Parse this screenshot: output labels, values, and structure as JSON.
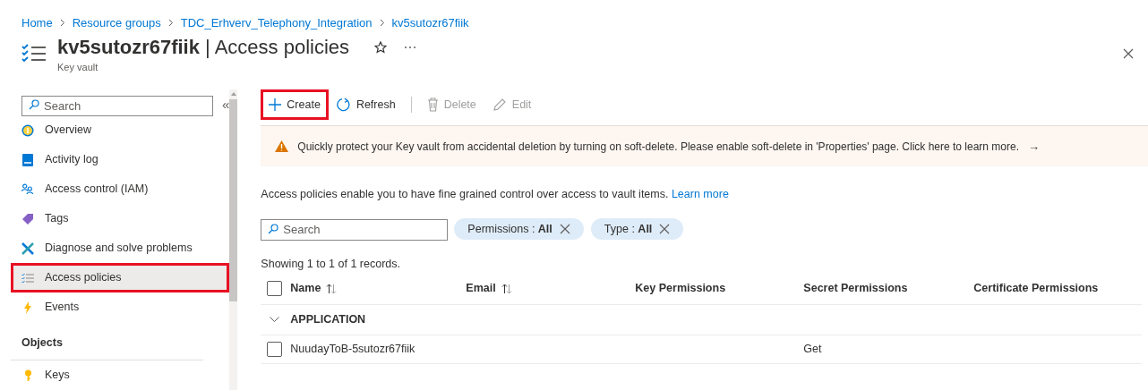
{
  "breadcrumb": [
    "Home",
    "Resource groups",
    "TDC_Erhverv_Telephony_Integration",
    "kv5sutozr67fiik"
  ],
  "header": {
    "title": "**kv5sutozr67fiik** | Access policies",
    "subtitle": "Key vault"
  },
  "sidebar": {
    "search": {
      "placeholder": "Search"
    },
    "collapse": "«",
    "items": [
      {
        "label": "Overview",
        "selected": false,
        "highlighted": false
      },
      {
        "label": "Activity log",
        "selected": false,
        "highlighted": false
      },
      {
        "label": "Access control (IAM)",
        "selected": false,
        "highlighted": false
      },
      {
        "label": "Tags",
        "selected": false,
        "highlighted": false
      },
      {
        "label": "Diagnose and solve problems",
        "selected": false,
        "highlighted": false
      },
      {
        "label": "Access policies",
        "selected": true,
        "highlighted": true
      },
      {
        "label": "Events",
        "selected": false,
        "highlighted": false
      }
    ],
    "sections": [
      {
        "title": "Objects",
        "items": [
          {
            "label": "Keys",
            "selected": false,
            "highlighted": false
          }
        ]
      }
    ]
  },
  "toolbar": [
    {
      "label": "Create",
      "disabled": false,
      "highlighted": true
    },
    {
      "label": "Refresh",
      "disabled": false,
      "highlighted": false
    },
    {
      "label": "Delete",
      "disabled": true,
      "highlighted": false
    },
    {
      "label": "Edit",
      "disabled": true,
      "highlighted": false
    }
  ],
  "banner": {
    "text": "Quickly protect your Key vault from accidental deletion by turning on soft-delete. Please enable soft-delete in 'Properties' page. Click here to learn more.",
    "arrow": "→"
  },
  "description": {
    "text": "Access policies enable you to have fine grained control over access to vault items.",
    "link": "Learn more"
  },
  "search": {
    "placeholder": "Search"
  },
  "filters": [
    {
      "label": "Permissions : ",
      "value": "All"
    },
    {
      "label": "Type : ",
      "value": "All"
    }
  ],
  "record_count": "Showing 1 to 1 of 1 records.",
  "table": {
    "select_all": {
      "checked": false
    },
    "columns": [
      {
        "label": "Name",
        "sortable": true
      },
      {
        "label": "Email",
        "sortable": true
      },
      {
        "label": "Key Permissions",
        "sortable": false
      },
      {
        "label": "Secret Permissions",
        "sortable": false
      },
      {
        "label": "Certificate Permissions",
        "sortable": false
      }
    ],
    "groups": [
      {
        "label": "APPLICATION",
        "expanded": true,
        "rows": [
          {
            "checked": false,
            "cells": [
              "NuudayToB-5sutozr67fiik",
              "",
              "",
              "Get",
              ""
            ]
          }
        ]
      }
    ]
  }
}
